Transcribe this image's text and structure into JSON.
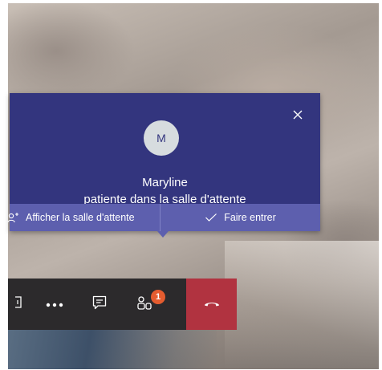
{
  "notification": {
    "avatar_initial": "M",
    "name": "Maryline",
    "message": "patiente dans la salle d'attente",
    "actions": {
      "show_lobby": "Afficher la salle d'attente",
      "admit": "Faire entrer"
    }
  },
  "toolbar": {
    "participants_badge": "1"
  },
  "colors": {
    "banner_bg": "#33357e",
    "action_bar_bg": "#5d5fae",
    "hangup": "#b13340",
    "badge": "#e55c2f"
  },
  "icons": [
    "close-icon",
    "add-person-icon",
    "check-icon",
    "share-screen-icon",
    "more-options-icon",
    "chat-icon",
    "participants-icon",
    "hang-up-icon"
  ]
}
